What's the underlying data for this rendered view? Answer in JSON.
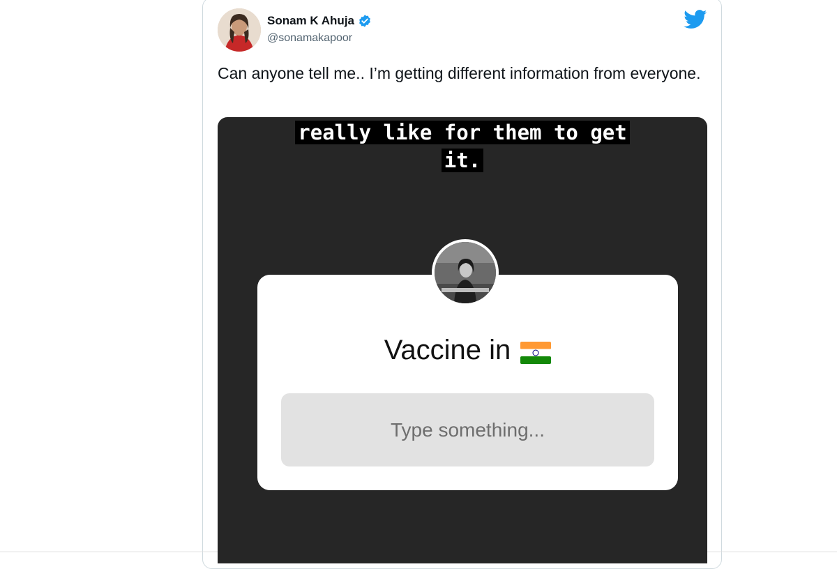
{
  "tweet": {
    "display_name": "Sonam K Ahuja",
    "handle": "@sonamakapoor",
    "text": "Can anyone tell me.. I’m getting different information from everyone.",
    "verified_icon": "verified-badge-icon",
    "platform_icon": "twitter-bird-icon"
  },
  "media": {
    "caption_line1": "really like for them to get",
    "caption_line2": "it.",
    "question": "Vaccine in",
    "question_flag": "india-flag-icon",
    "input_placeholder": "Type something..."
  },
  "colors": {
    "twitter_blue": "#1d9bf0",
    "story_background": "#262626",
    "input_background": "#e2e2e2"
  }
}
